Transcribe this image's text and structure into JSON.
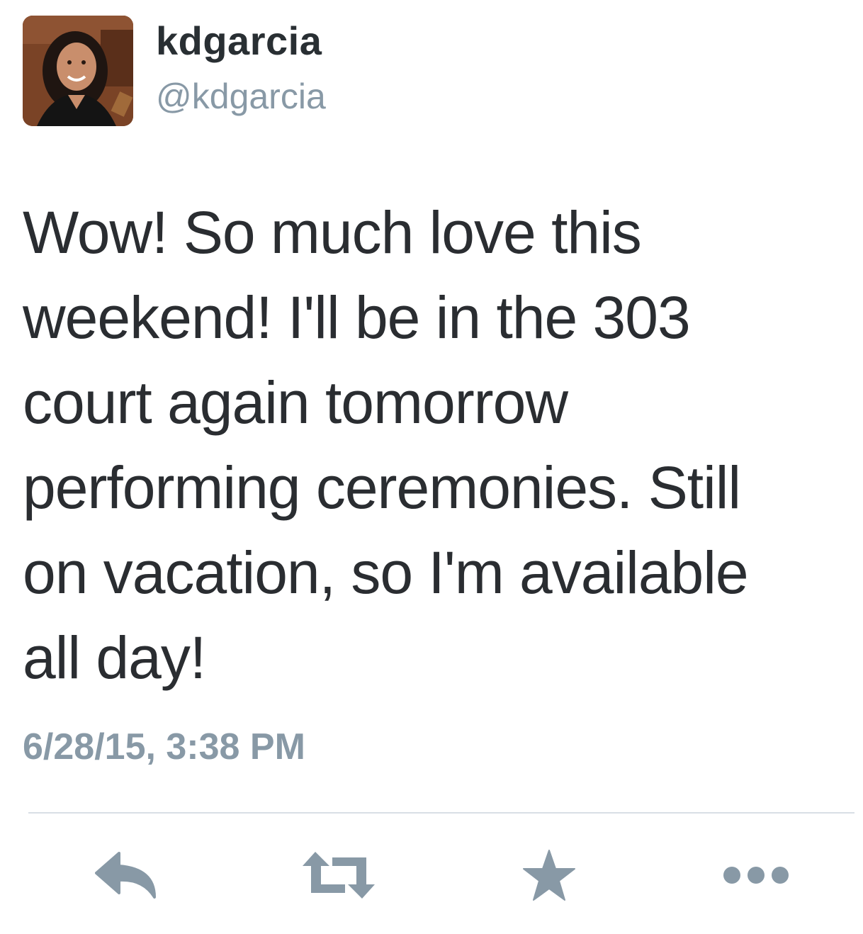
{
  "author": {
    "display_name": "kdgarcia",
    "handle": "@kdgarcia",
    "avatar_icon": "profile-photo"
  },
  "tweet": {
    "lines": [
      "Wow! So much love this",
      "weekend! I'll be in the 303",
      "court again tomorrow",
      "performing ceremonies. Still",
      "on vacation, so I'm available",
      "all day!"
    ],
    "timestamp": "6/28/15, 3:38 PM"
  },
  "actions": [
    {
      "name": "reply",
      "icon": "reply-icon"
    },
    {
      "name": "retweet",
      "icon": "retweet-icon"
    },
    {
      "name": "favorite",
      "icon": "star-icon"
    },
    {
      "name": "more",
      "icon": "more-icon"
    }
  ],
  "colors": {
    "text": "#2a2d31",
    "secondary": "#8899a6",
    "icon": "#8899a6",
    "divider": "#d8dfe5"
  }
}
